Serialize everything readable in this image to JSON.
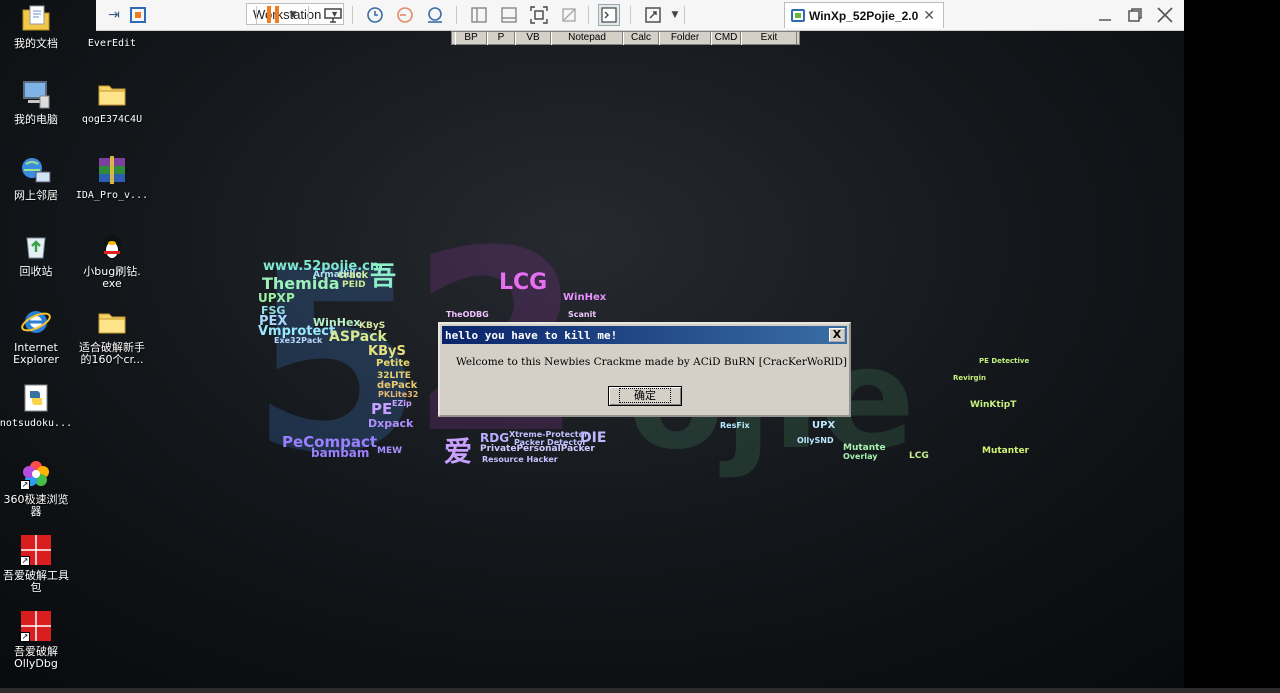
{
  "vmware": {
    "workstation_menu_label": "Workstation",
    "tab_label": "WinXp_52Pojie_2.0",
    "tab_close": "✕",
    "icons": [
      "unity-icon",
      "library-icon",
      "pause-icon",
      "send-ctrl-alt-del-icon",
      "snapshot-icon",
      "revert-snapshot-icon",
      "snapshot-manager-icon",
      "view-sidebar-icon",
      "view-console-icon",
      "fullscreen-icon",
      "unity-mode-icon",
      "terminal-icon",
      "stretch-icon",
      "minimize-icon",
      "maximize-icon",
      "close-icon"
    ]
  },
  "launcher": {
    "buttons": [
      "BP",
      "P",
      "VB",
      "Notepad",
      "Calc",
      "Folder",
      "CMD",
      "Exit"
    ]
  },
  "desktop": {
    "icons": [
      {
        "label": "我的文档",
        "icon": "my-documents-icon"
      },
      {
        "label": "EverEdit",
        "icon": "everedit-icon"
      },
      {
        "label": "我的电脑",
        "icon": "my-computer-icon"
      },
      {
        "label": "qogE374C4U",
        "icon": "folder-icon"
      },
      {
        "label": "网上邻居",
        "icon": "network-icon"
      },
      {
        "label": "IDA_Pro_v...",
        "icon": "winrar-archive-icon"
      },
      {
        "label": "回收站",
        "icon": "recycle-bin-icon"
      },
      {
        "label": "小bug刷钻.\nexe",
        "icon": "qq-penguin-icon"
      },
      {
        "label": "Internet\nExplorer",
        "icon": "internet-explorer-icon"
      },
      {
        "label": "适合破解新手\n的160个cr...",
        "icon": "folder-icon"
      },
      {
        "label": "notsudoku...",
        "icon": "python-icon"
      },
      {
        "label": "360极速浏览\n器",
        "icon": "browser-360-icon"
      },
      {
        "label": "吾爱破解工具\n包",
        "icon": "52pojie-toolkit-icon"
      },
      {
        "label": "吾爱破解\nOllyDbg",
        "icon": "52pojie-ollydbg-icon"
      }
    ]
  },
  "wallpaper": {
    "words": [
      "www.52pojie.cn",
      "吾",
      "Themida",
      "PEID",
      "Armadillo",
      "crack",
      "UPX",
      "P",
      "FSG",
      "PEX",
      "WinHex",
      "KByS",
      "Vmprotect",
      "ASPack",
      "Exe32Pack",
      "KByS",
      "Petite",
      "32LITE",
      "dePack",
      "PKLite32",
      "PE",
      "EZip",
      "Dxpack",
      "PeCompact",
      "bambam",
      "MEW",
      "LCG",
      "WinHex",
      "Scanit",
      "TheODBG",
      "爱",
      "RDG",
      "DIE",
      "Xtreme-Protector",
      "Packer Detector",
      "PrivatePersonalPacker",
      "Resource Hacker",
      "UPX",
      "OllySND",
      "ResFix",
      "Mutante",
      "Overlay",
      "LCG",
      "WinKtipT",
      "Mutanter",
      "PE Detective",
      "Revirgin"
    ]
  },
  "dialog": {
    "title": "hello you have to kill me!",
    "close": "X",
    "message": "Welcome to this Newbies Crackme made by ACiD BuRN [CracKerWoRlD]",
    "ok_label": "确定"
  }
}
